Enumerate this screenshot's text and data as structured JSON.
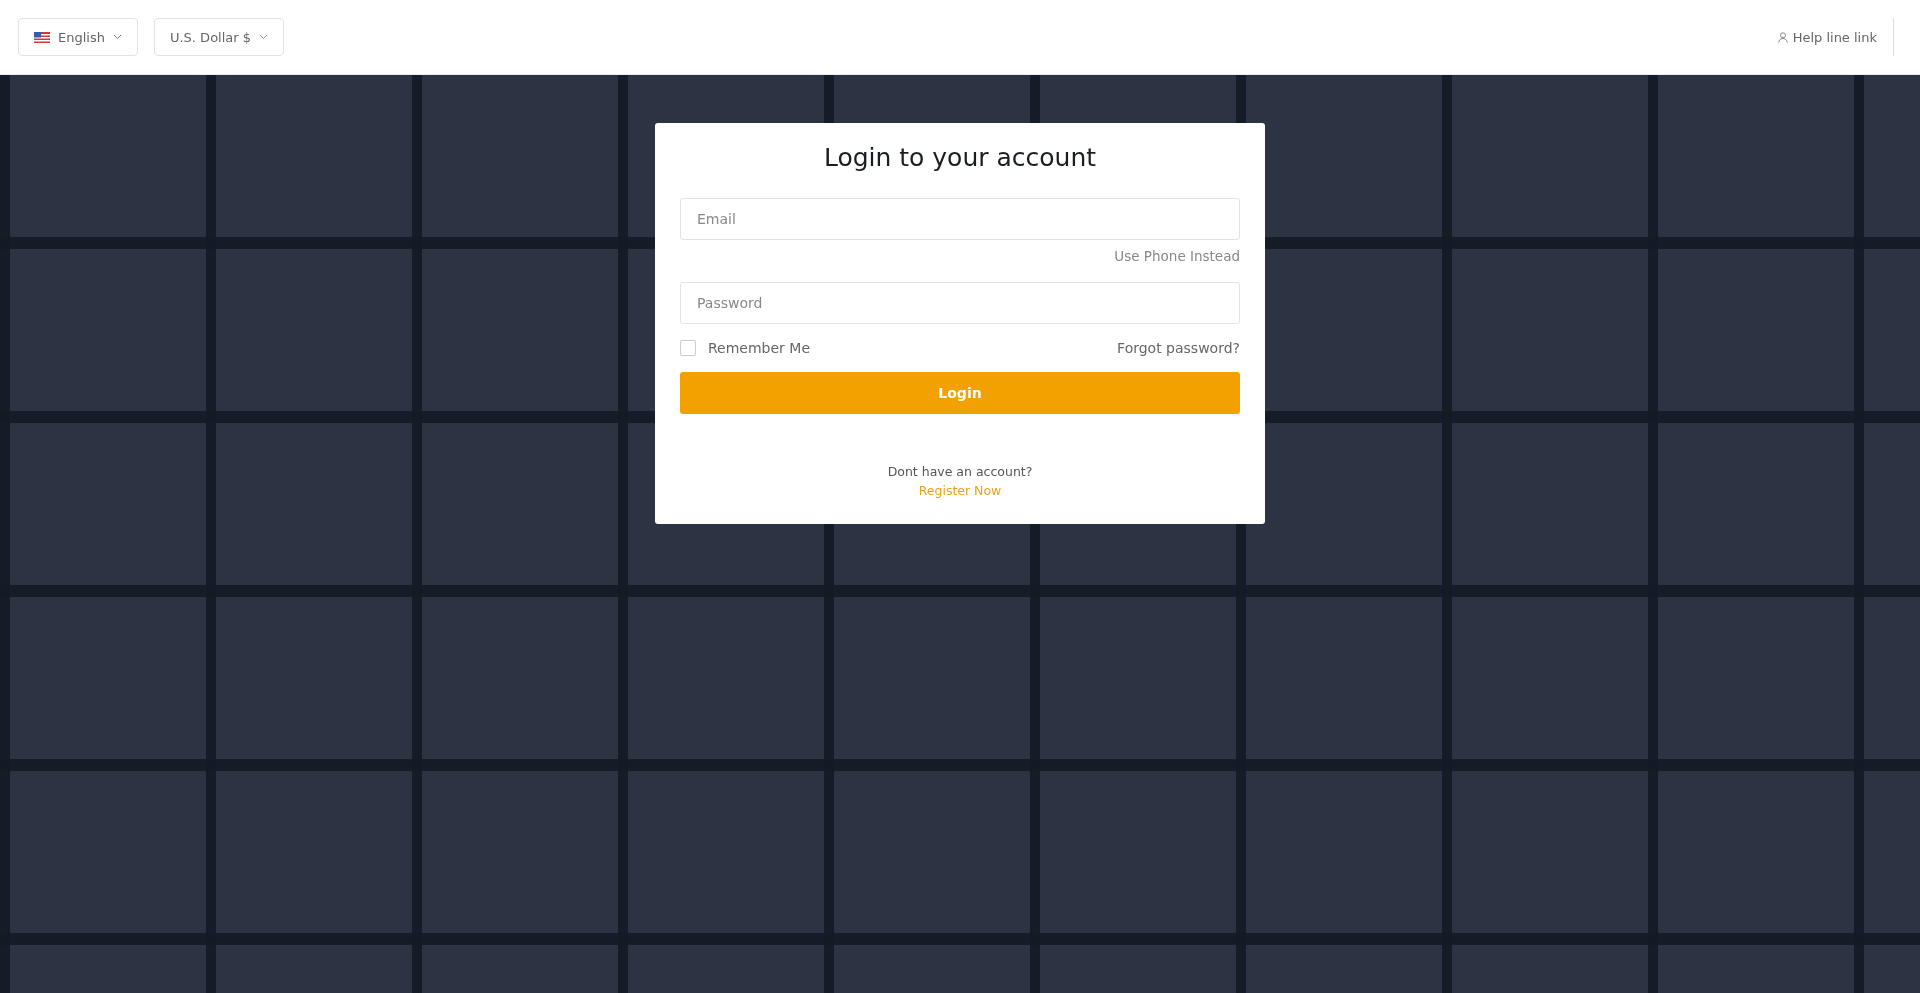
{
  "header": {
    "language": {
      "label": "English"
    },
    "currency": {
      "label": "U.S. Dollar $"
    },
    "help_link": "Help line link"
  },
  "login": {
    "title": "Login to your account",
    "email": {
      "placeholder": "Email"
    },
    "use_phone": "Use Phone Instead",
    "password": {
      "placeholder": "Password"
    },
    "remember_me": {
      "label": "Remember Me",
      "checked": false
    },
    "forgot_password": "Forgot password?",
    "login_button": "Login",
    "no_account": "Dont have an account?",
    "register": "Register Now"
  }
}
